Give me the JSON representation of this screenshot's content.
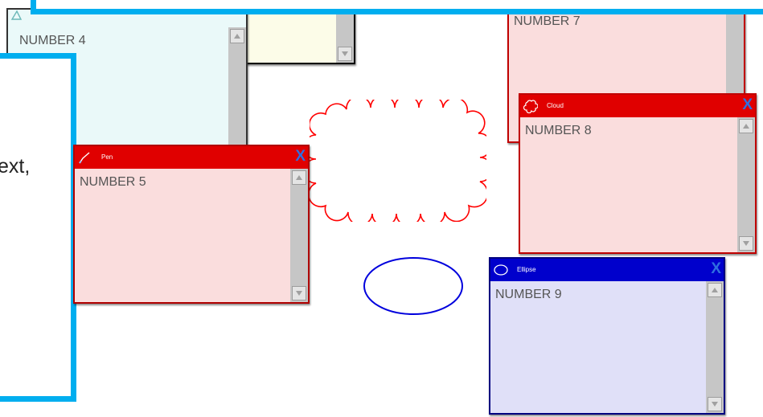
{
  "windows": {
    "number4": {
      "text": "NUMBER 4"
    },
    "number7": {
      "text": "NUMBER 7"
    },
    "pen": {
      "title": "Pen",
      "close": "X",
      "text": "NUMBER 5"
    },
    "cloud": {
      "title": "Cloud",
      "close": "X",
      "text": "NUMBER 8"
    },
    "ellipse": {
      "title": "Ellipse",
      "close": "X",
      "text": "NUMBER 9"
    }
  },
  "overlay": {
    "partial_text": "ext,"
  },
  "colors": {
    "red_title": "#e00000",
    "red_body": "#fadddd",
    "blue_title": "#0000cc",
    "blue_body": "#e0e0f8",
    "teal_body": "#eaf9f9",
    "yellow_body": "#fcfce8",
    "overlay_frame": "#00aeef",
    "cloud_stroke": "#ff0000",
    "ellipse_stroke": "#0000dd"
  },
  "icons": {
    "pen": "pen-icon",
    "cloud": "cloud-icon",
    "ellipse": "ellipse-icon",
    "close": "close-icon",
    "scroll_up": "scroll-up-arrow-icon",
    "scroll_down": "scroll-down-arrow-icon"
  }
}
